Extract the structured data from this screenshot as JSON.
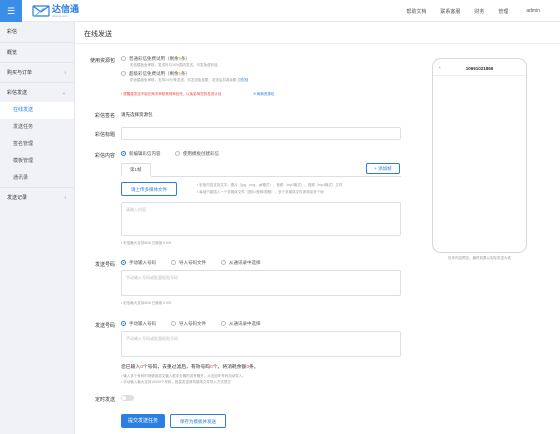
{
  "topbar": {
    "menu_icon": "☰",
    "logo_name": "达信通",
    "logo_sub": "dxtong.com",
    "links": [
      "帮助文档",
      "联系客服",
      "财务",
      "管理",
      "admin"
    ]
  },
  "sidebar": {
    "items": [
      {
        "label": "彩信"
      },
      {
        "label": "概览"
      },
      {
        "label": "购买与订单",
        "chev": "›"
      },
      {
        "label": "彩信发送",
        "chev": "⌄"
      }
    ],
    "subs": [
      "在线发送",
      "发送任务",
      "签名管理",
      "模板管理",
      "通讯录"
    ],
    "last": {
      "label": "发送记录",
      "chev": "›"
    }
  },
  "main": {
    "title": "在线发送",
    "resource": {
      "label": "使用资源包",
      "opt1": "普通彩信免费试用（剩余",
      "opt1_count": "5",
      "opt1_tail": "条）",
      "opt1_hint": "彩信模板免审核，发送时与10%国内发送，可发免费彩信。",
      "opt2": "超级彩信免费试用（剩余",
      "opt2_count": "5",
      "opt2_tail": "条）",
      "opt2_hint": "彩信模板免审核，支持24元/条发送，仅发送免费额，发送后扣减余额",
      "opt2_link": "【关闭】",
      "warn": "• 提醒重发送不能在两次审核常规审批完，以免影响您的发送计划",
      "warn_link": "⟲ 刷新资源包"
    },
    "sign": {
      "label": "彩信签名",
      "value": "请先选择资源包"
    },
    "title_field": {
      "label": "彩信标题"
    },
    "content": {
      "label": "彩信内容",
      "opt1": "新编辑彩信内容",
      "opt2": "使用模板创建彩信",
      "tab": "第1帧",
      "add": "+ 添加帧",
      "upload": "请上传多媒体文件",
      "hint1": "• 彩信内容支持文字、图片（jpg、png、gif格式）、音频（mp3格式）、视频（mp4格式）文件",
      "hint2": "• 每帧只能插入一个多媒体文件（图片/音频/视频），多个多媒体文件请添加多个帧",
      "placeholder": "请输入内容",
      "count": "• 彩信最大支持0KB 已使用 0 KB"
    },
    "phone1": {
      "label": "发送号码",
      "opt1": "手动输入号码",
      "opt2": "导入号码文件",
      "opt3": "从通讯录中选择",
      "placeholder": "手动输入号码或批量粘贴号码",
      "count": "• 彩信最大支持0KB 已使用 0 KB"
    },
    "phone2": {
      "label": "发送号码",
      "opt1": "手动输入号码",
      "opt2": "导入号码文件",
      "opt3": "从通讯录中选择",
      "placeholder": "手动输入号码或批量粘贴号码",
      "summary_a": "您已输入",
      "summary_b": "0",
      "summary_c": "个号码，去重过滤后，有效号码",
      "summary_d": "0",
      "summary_e": "个，将消耗余额",
      "summary_f": "0",
      "summary_g": "条。",
      "hint1": "• 输入多个号码时请使用英文输入框中分隔的逗号隔开，点击回车号码自动导入。",
      "hint2": "• 手动输入最大支持10000个号码，批量发送请将使用文件导入方式提交"
    },
    "schedule": {
      "label": "定时发送"
    },
    "submit": "提交发送任务",
    "save_tpl": "保存为模板并发送",
    "preview": {
      "title": "10691021866",
      "back": "‹",
      "caption": "仅作内容预览，最终效果以实际发送为准"
    }
  }
}
